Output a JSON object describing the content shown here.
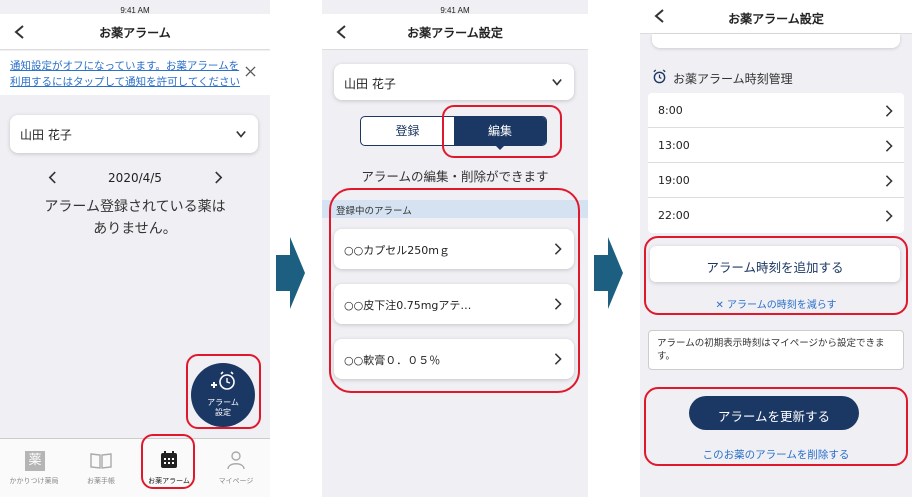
{
  "screen1": {
    "status_time": "9:41 AM",
    "title": "お薬アラーム",
    "notice_line1": "通知設定がオフになっています。お薬アラームを",
    "notice_line2": "利用するにはタップして通知を許可してください",
    "patient": "山田 花子",
    "date": "2020/4/5",
    "empty_line1": "アラーム登録されている薬は",
    "empty_line2": "ありません。",
    "fab_line1": "アラーム",
    "fab_line2": "設定",
    "tabs": [
      {
        "label": "かかりつけ薬局",
        "icon": "pharmacy-icon"
      },
      {
        "label": "お薬手帳",
        "icon": "book-icon"
      },
      {
        "label": "お薬アラーム",
        "icon": "calendar-icon"
      },
      {
        "label": "マイページ",
        "icon": "person-icon"
      }
    ],
    "tab_icon_text": "薬"
  },
  "screen2": {
    "status_time": "9:41 AM",
    "title": "お薬アラーム設定",
    "patient": "山田 花子",
    "segment_register": "登録",
    "segment_edit": "編集",
    "hint": "アラームの編集・削除ができます",
    "section": "登録中のアラーム",
    "items": [
      "○○カプセル250mｇ",
      "○○皮下注0.75mgアテ…",
      "○○軟膏０．０５％"
    ]
  },
  "screen3": {
    "title": "お薬アラーム設定",
    "section": "お薬アラーム時刻管理",
    "times": [
      "8:00",
      "13:00",
      "19:00",
      "22:00"
    ],
    "add_button": "アラーム時刻を追加する",
    "reduce_link": "✕ アラームの時刻を減らす",
    "info": "アラームの初期表示時刻はマイページから設定できます。",
    "update_button": "アラームを更新する",
    "delete_link": "このお薬のアラームを削除する"
  },
  "colors": {
    "navy": "#1b3763",
    "link": "#2a6fc9",
    "highlight": "#e0182b",
    "arrow": "#1c5f80",
    "section_bg": "#d4e2f2"
  }
}
